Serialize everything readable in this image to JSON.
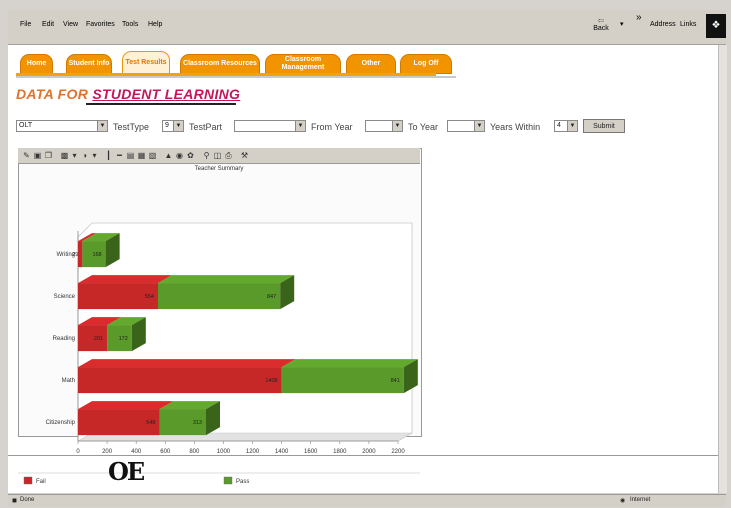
{
  "browser": {
    "menu": [
      "File",
      "Edit",
      "View",
      "Favorites",
      "Tools",
      "Help"
    ],
    "back_label": "Back",
    "address_label": "Address",
    "links_label": "Links",
    "status_left": "Done",
    "status_right": "Internet"
  },
  "nav": {
    "tabs": [
      {
        "label": "Home"
      },
      {
        "label": "Student Info"
      },
      {
        "label": "Test Results"
      },
      {
        "label": "Classroom Resources"
      },
      {
        "label": "Classroom Management"
      },
      {
        "label": "Other"
      },
      {
        "label": "Log Off"
      }
    ],
    "active_tab": "Test Results"
  },
  "page": {
    "title_prefix": "DATA FOR ",
    "title_emphasis": "STUDENT LEARNING"
  },
  "filters": {
    "test": "OLT",
    "test_type_label": "TestType",
    "test_type_value": "9",
    "test_part_label": "TestPart",
    "test_part_value": "",
    "from_year_label": "From Year",
    "from_year_value": "",
    "to_year_label": "To Year",
    "to_year_value": "",
    "years_within_label": "Years Within",
    "years_within_value": "4",
    "submit_label": "Submit"
  },
  "chart_data": {
    "type": "bar",
    "orientation": "horizontal",
    "stacked": true,
    "title": "Teacher Summary",
    "categories": [
      "Citizenship",
      "Math",
      "Reading",
      "Science",
      "Writing"
    ],
    "series": [
      {
        "name": "Fail",
        "color": "#c62828",
        "values": [
          560,
          1400,
          200,
          550,
          30
        ],
        "labels": [
          "548",
          "1408",
          "201",
          "554",
          "29"
        ]
      },
      {
        "name": "Pass",
        "color": "#5a9a2a",
        "values": [
          320,
          840,
          170,
          840,
          160
        ],
        "labels": [
          "313",
          "841",
          "172",
          "847",
          "168"
        ]
      }
    ],
    "xlim": [
      0,
      2200
    ],
    "xticks": [
      0,
      200,
      400,
      600,
      800,
      1000,
      1200,
      1400,
      1600,
      1800,
      2000,
      2200
    ],
    "legend": "bottom"
  },
  "footer": {
    "logo_text": "OE"
  }
}
